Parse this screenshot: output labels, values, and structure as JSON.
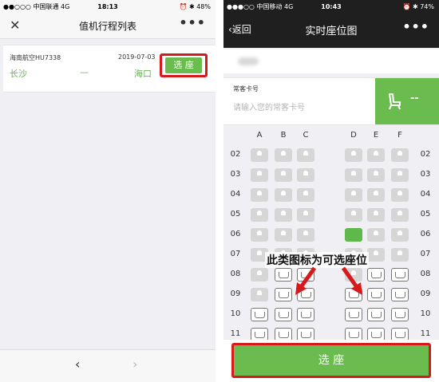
{
  "left": {
    "status": {
      "carrier": "●●○○○ 中国联通  4G",
      "time": "18:13",
      "battery": "⏰ ✱ 48%"
    },
    "nav": {
      "close": "✕",
      "title": "值机行程列表",
      "more": "•••"
    },
    "flight": {
      "flight_no": "海南航空HU7338",
      "date": "2019-07-03",
      "from": "长沙",
      "dash": "—",
      "to": "海口",
      "select_label": "选 座"
    },
    "bottom": {
      "back": "‹",
      "forward": "›"
    }
  },
  "right": {
    "status": {
      "carrier": "●●●○○ 中国移动  4G",
      "time": "10:43",
      "battery": "⏰ ✱ 74%"
    },
    "nav": {
      "back": "‹返回",
      "title": "实时座位图",
      "more": "•••"
    },
    "card": {
      "label": "常客卡号",
      "placeholder": "请输入您的常客卡号",
      "seat_display": "--"
    },
    "columns_left": [
      "A",
      "B",
      "C"
    ],
    "columns_right": [
      "D",
      "E",
      "F"
    ],
    "rows": [
      {
        "label": "02",
        "seats": [
          "occ",
          "occ",
          "occ",
          "occ",
          "occ",
          "occ"
        ]
      },
      {
        "label": "03",
        "seats": [
          "occ",
          "occ",
          "occ",
          "occ",
          "occ",
          "occ"
        ]
      },
      {
        "label": "04",
        "seats": [
          "occ",
          "occ",
          "occ",
          "occ",
          "occ",
          "occ"
        ]
      },
      {
        "label": "05",
        "seats": [
          "occ",
          "occ",
          "occ",
          "occ",
          "occ",
          "occ"
        ]
      },
      {
        "label": "06",
        "seats": [
          "occ",
          "occ",
          "occ",
          "sel",
          "occ",
          "occ"
        ]
      },
      {
        "label": "07",
        "seats": [
          "occ",
          "occ",
          "occ",
          "occ",
          "occ",
          "occ"
        ]
      },
      {
        "label": "08",
        "seats": [
          "occ",
          "avail",
          "avail",
          "occ",
          "avail",
          "avail"
        ]
      },
      {
        "label": "09",
        "seats": [
          "occ",
          "avail",
          "avail",
          "avail",
          "avail",
          "avail"
        ]
      },
      {
        "label": "10",
        "seats": [
          "avail",
          "avail",
          "avail",
          "avail",
          "avail",
          "avail"
        ]
      },
      {
        "label": "11",
        "seats": [
          "avail",
          "avail",
          "avail",
          "avail",
          "avail",
          "avail"
        ]
      }
    ],
    "annotation": "此类图标为可选座位",
    "select_button": "选 座"
  },
  "colors": {
    "accent_green": "#6bbc4e",
    "highlight_red": "#d7191b",
    "dark_bar": "#1f1f1f"
  }
}
